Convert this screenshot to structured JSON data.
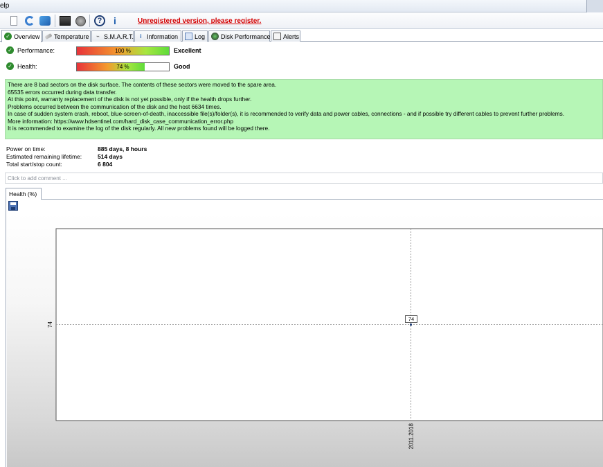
{
  "menu": {
    "partial_label": "elp"
  },
  "toolbar": {
    "register_text": "Unregistered version, please register.",
    "icons": [
      "document-icon",
      "refresh-icon",
      "globe-icon",
      "disk-icon",
      "dial-icon",
      "help-icon",
      "info-icon"
    ],
    "help_glyph": "?",
    "info_glyph": "i"
  },
  "tabs": [
    {
      "label": "Overview",
      "icon": "check-icon"
    },
    {
      "label": "Temperature",
      "icon": "thermometer-icon"
    },
    {
      "label": "S.M.A.R.T.",
      "icon": "smart-icon"
    },
    {
      "label": "Information",
      "icon": "info-icon"
    },
    {
      "label": "Log",
      "icon": "log-icon"
    },
    {
      "label": "Disk Performance",
      "icon": "performance-icon"
    },
    {
      "label": "Alerts",
      "icon": "alerts-icon"
    }
  ],
  "status": {
    "performance": {
      "label": "Performance:",
      "value": 100,
      "value_text": "100 %",
      "rating": "Excellent"
    },
    "health": {
      "label": "Health:",
      "value": 74,
      "value_text": "74 %",
      "rating": "Good"
    }
  },
  "message": [
    "There are 8 bad sectors on the disk surface. The contents of these sectors were moved to the spare area.",
    "65535 errors occurred during data transfer.",
    "At this point, warranty replacement of the disk is not yet possible, only if the health drops further.",
    "Problems occurred between the communication of the disk and the host 6634 times.",
    "In case of sudden system crash, reboot, blue-screen-of-death, inaccessible file(s)/folder(s), it is recommended to verify data and power cables, connections - and if possible try different cables to prevent further problems.",
    "More information: https://www.hdsentinel.com/hard_disk_case_communication_error.php",
    "It is recommended to examine the log of the disk regularly. All new problems found will be logged there."
  ],
  "info": {
    "power_on_label": "Power on time:",
    "power_on_value": "885 days, 8 hours",
    "lifetime_label": "Estimated remaining lifetime:",
    "lifetime_value": "514 days",
    "startstop_label": "Total start/stop count:",
    "startstop_value": "6 804"
  },
  "comment": {
    "placeholder": "Click to add comment ..."
  },
  "chart_tab": {
    "label": "Health (%)"
  },
  "colors": {
    "register": "#d40000",
    "message_bg": "#b6f6b6",
    "ok_green": "#2e8b2e"
  },
  "chart_data": {
    "type": "line",
    "title": "",
    "xlabel": "",
    "ylabel": "",
    "x": [
      "2011.2018"
    ],
    "series": [
      {
        "values": [
          74
        ]
      }
    ],
    "ytick_labels": [
      "74"
    ],
    "xtick_labels": [
      "2011.2018"
    ],
    "data_labels": [
      "74"
    ],
    "grid": true,
    "legend": "none"
  }
}
